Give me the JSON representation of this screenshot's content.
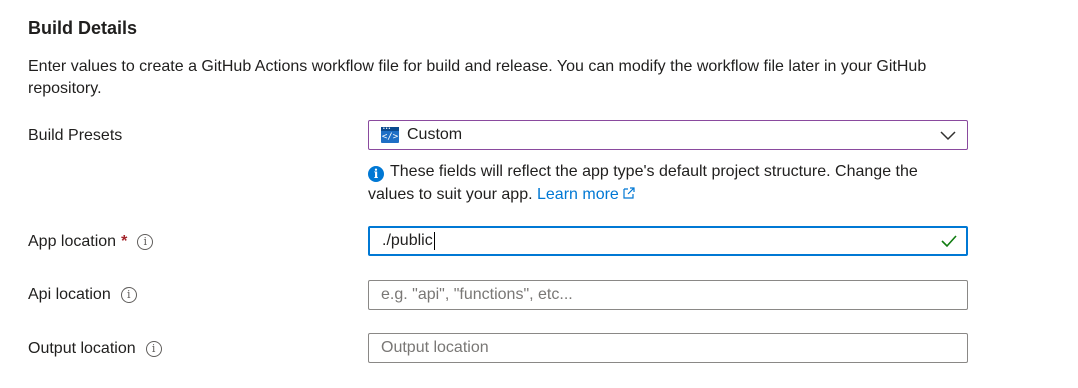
{
  "section": {
    "title": "Build Details",
    "description": "Enter values to create a GitHub Actions workflow file for build and release. You can modify the workflow file later in your GitHub repository."
  },
  "build_presets": {
    "label": "Build Presets",
    "selected": "Custom",
    "icon": "code-window-icon",
    "hint_text": "These fields will reflect the app type's default project structure. Change the values to suit your app.",
    "learn_more": "Learn more"
  },
  "app_location": {
    "label": "App location",
    "required_mark": "*",
    "value": "./public",
    "valid": true
  },
  "api_location": {
    "label": "Api location",
    "value": "",
    "placeholder": "e.g. \"api\", \"functions\", etc..."
  },
  "output_location": {
    "label": "Output location",
    "value": "",
    "placeholder": "Output location"
  },
  "colors": {
    "accent": "#0078d4",
    "valid": "#107c10",
    "required": "#a4262c"
  }
}
